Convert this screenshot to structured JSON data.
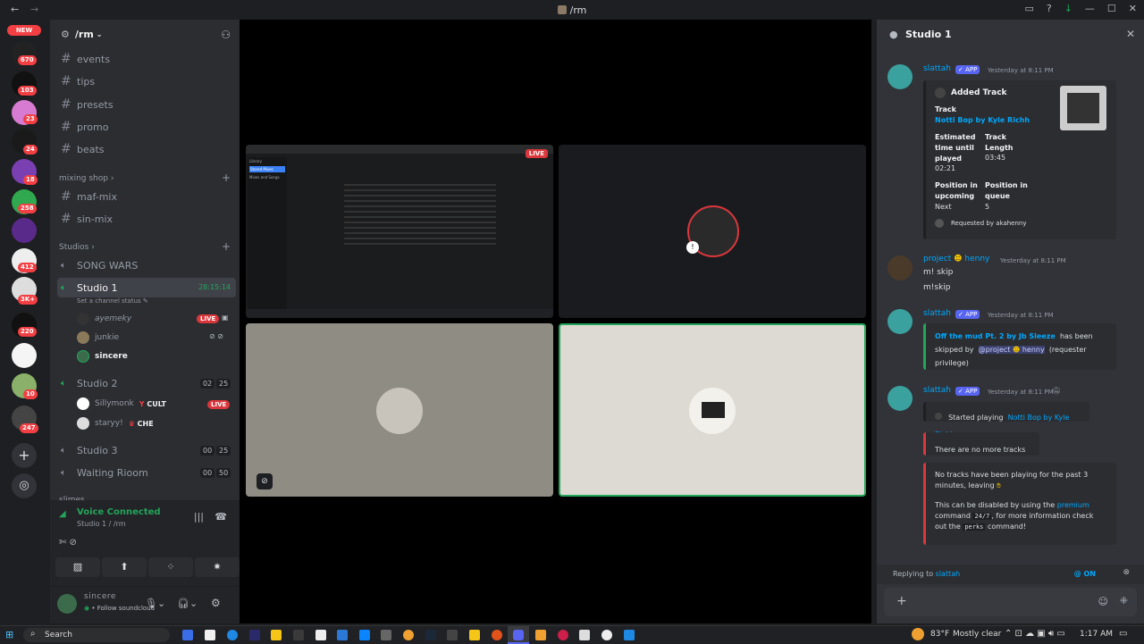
{
  "window": {
    "title": "/rm"
  },
  "server_rail": {
    "new_label": "NEW",
    "badges": [
      "670",
      "103",
      "23",
      "24",
      "18",
      "258",
      "412",
      "3K+",
      "220",
      "10",
      "247"
    ]
  },
  "sidebar": {
    "server_name": "/rm",
    "channels": [
      "events",
      "tips",
      "presets",
      "promo",
      "beats"
    ],
    "category_mixing": "mixing shop",
    "mixing_channels": [
      "maf-mix",
      "sin-mix"
    ],
    "category_studios": "Studios",
    "song_wars": "SONG WARS",
    "studio1": {
      "name": "Studio 1",
      "timer": "28:15:14",
      "status": "Set a channel status"
    },
    "studio1_users": [
      "ayemeky",
      "junkie",
      "sincere"
    ],
    "studio2": {
      "name": "Studio 2",
      "count_a": "02",
      "count_b": "25"
    },
    "studio2_users": [
      {
        "name": "Sillymonk",
        "tag": "CULT"
      },
      {
        "name": "staryy!",
        "tag": "CHE"
      }
    ],
    "studio3": {
      "name": "Studio 3",
      "count_a": "00",
      "count_b": "25"
    },
    "waiting": {
      "name": "Waiting Rioom",
      "count_a": "00",
      "count_b": "50"
    },
    "live": "LIVE",
    "cut_category": "slimes"
  },
  "voice": {
    "status": "Voice Connected",
    "location": "Studio 1 / /rm"
  },
  "user": {
    "name": "sincere",
    "status": "Follow soundcloud"
  },
  "stage": {
    "live": "LIVE",
    "screen_share_sidebar": [
      "Library",
      "Stored Mixes",
      "Mixes and Songs"
    ]
  },
  "chat": {
    "header": "Studio 1",
    "messages": [
      {
        "author": "slattah",
        "app": "APP",
        "time": "Yesterday at 8:11 PM",
        "embed": {
          "title": "Added Track",
          "track_label": "Track",
          "track_value": "Notti Bop by Kyle Richh",
          "est_label": "Estimated time until played",
          "est_value": "02:21",
          "len_label": "Track Length",
          "len_value": "03:45",
          "pos_upcoming_label": "Position in upcoming",
          "pos_upcoming_value": "Next",
          "pos_queue_label": "Position in queue",
          "pos_queue_value": "5",
          "requested": "Requested by akahenny"
        }
      },
      {
        "author": "project",
        "author2": "henny",
        "time": "Yesterday at 8:11 PM",
        "lines": [
          "m! skip",
          "m!skip"
        ]
      },
      {
        "author": "slattah",
        "app": "APP",
        "time": "Yesterday at 8:11 PM",
        "embed": {
          "link": "Off the mud Pt. 2 by Jb Sleeze",
          "text1": "has been skipped by",
          "mention": "@project",
          "mention2": "henny",
          "text2": "(requester privilege)"
        }
      },
      {
        "author": "slattah",
        "app": "APP",
        "time": "Yesterday at 8:11 PM",
        "started_prefix": "Started playing",
        "started_link": "Notti Bop by Kyle Richh",
        "no_more": "There are no more tracks",
        "leaving": "No tracks have been playing for the past 3 minutes, leaving",
        "disable_1": "This can be disabled by using the",
        "premium": "premium",
        "disable_2": "command",
        "code1": "24/7",
        "disable_3": ", for more information check out the",
        "code2": "perks",
        "disable_4": "command!"
      }
    ],
    "replying_prefix": "Replying to",
    "replying_to": "slattah",
    "mention_toggle": "@ ON"
  },
  "taskbar": {
    "search": "Search",
    "weather": "83°F",
    "weather_desc": "Mostly clear",
    "time": "1:17 AM"
  },
  "colors": {
    "accent": "#5865f2",
    "live": "#da373c",
    "voice_green": "#23a55a",
    "link": "#00a8fc"
  }
}
